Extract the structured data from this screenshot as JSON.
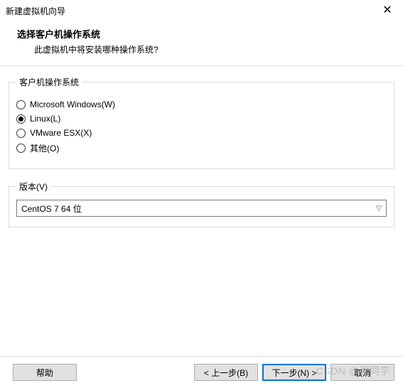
{
  "window": {
    "title": "新建虚拟机向导"
  },
  "header": {
    "heading": "选择客户机操作系统",
    "subtext": "此虚拟机中将安装哪种操作系统?"
  },
  "os_group": {
    "legend": "客户机操作系统",
    "options": [
      {
        "label": "Microsoft Windows(W)",
        "checked": false
      },
      {
        "label": "Linux(L)",
        "checked": true
      },
      {
        "label": "VMware ESX(X)",
        "checked": false
      },
      {
        "label": "其他(O)",
        "checked": false
      }
    ]
  },
  "version_group": {
    "legend": "版本(V)",
    "selected": "CentOS 7 64 位"
  },
  "footer": {
    "help": "帮助",
    "back": "< 上一步(B)",
    "next": "下一步(N) >",
    "cancel": "取消"
  },
  "watermark": "CSDN @程同学"
}
